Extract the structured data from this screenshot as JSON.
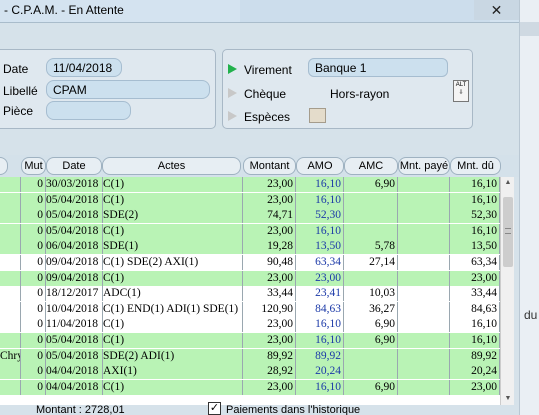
{
  "window": {
    "title": "- C.P.A.M. - En Attente",
    "close_glyph": "✕",
    "side_text": "du"
  },
  "form": {
    "date_label": "Date",
    "date_value": "11/04/2018",
    "libelle_label": "Libellé",
    "libelle_value": "CPAM",
    "piece_label": "Pièce",
    "piece_value": ""
  },
  "payment": {
    "virement_label": "Virement",
    "bank_value": "Banque 1",
    "alt_label": "ALT",
    "cheque_label": "Chèque",
    "horsrayon_label": "Hors-rayon",
    "especes_label": "Espèces",
    "selected": "Virement",
    "selected_color": "#22b14c"
  },
  "table": {
    "headers": [
      "Mut",
      "Date",
      "Actes",
      "Montant",
      "AMO",
      "AMC",
      "Mnt. payé",
      "Mnt. dû"
    ],
    "rows": [
      {
        "first": "",
        "mut": "0",
        "date": "30/03/2018",
        "actes": "C(1)",
        "montant": "23,00",
        "amo": "16,10",
        "amc": "6,90",
        "paye": "",
        "du": "16,10",
        "green": true
      },
      {
        "first": "",
        "mut": "0",
        "date": "05/04/2018",
        "actes": "C(1)",
        "montant": "23,00",
        "amo": "16,10",
        "amc": "",
        "paye": "",
        "du": "16,10",
        "green": true
      },
      {
        "first": "",
        "mut": "0",
        "date": "05/04/2018",
        "actes": "SDE(2)",
        "montant": "74,71",
        "amo": "52,30",
        "amc": "",
        "paye": "",
        "du": "52,30",
        "green": true
      },
      {
        "first": "",
        "mut": "0",
        "date": "05/04/2018",
        "actes": "C(1)",
        "montant": "23,00",
        "amo": "16,10",
        "amc": "",
        "paye": "",
        "du": "16,10",
        "green": true
      },
      {
        "first": "",
        "mut": "0",
        "date": "06/04/2018",
        "actes": "SDE(1)",
        "montant": "19,28",
        "amo": "13,50",
        "amc": "5,78",
        "paye": "",
        "du": "13,50",
        "green": true
      },
      {
        "first": "",
        "mut": "0",
        "date": "09/04/2018",
        "actes": "C(1) SDE(2) AXI(1)",
        "montant": "90,48",
        "amo": "63,34",
        "amc": "27,14",
        "paye": "",
        "du": "63,34",
        "green": false
      },
      {
        "first": "",
        "mut": "0",
        "date": "09/04/2018",
        "actes": "C(1)",
        "montant": "23,00",
        "amo": "23,00",
        "amc": "",
        "paye": "",
        "du": "23,00",
        "green": true
      },
      {
        "first": "",
        "mut": "0",
        "date": "18/12/2017",
        "actes": "ADC(1)",
        "montant": "33,44",
        "amo": "23,41",
        "amc": "10,03",
        "paye": "",
        "du": "33,44",
        "green": false
      },
      {
        "first": "",
        "mut": "0",
        "date": "10/04/2018",
        "actes": "C(1) END(1) ADI(1) SDE(1)",
        "montant": "120,90",
        "amo": "84,63",
        "amc": "36,27",
        "paye": "",
        "du": "84,63",
        "green": false
      },
      {
        "first": "",
        "mut": "0",
        "date": "11/04/2018",
        "actes": "C(1)",
        "montant": "23,00",
        "amo": "16,10",
        "amc": "6,90",
        "paye": "",
        "du": "16,10",
        "green": false
      },
      {
        "first": "",
        "mut": "0",
        "date": "05/04/2018",
        "actes": "C(1)",
        "montant": "23,00",
        "amo": "16,10",
        "amc": "6,90",
        "paye": "",
        "du": "16,10",
        "green": true
      },
      {
        "first": "Chry",
        "mut": "0",
        "date": "05/04/2018",
        "actes": "SDE(2) ADI(1)",
        "montant": "89,92",
        "amo": "89,92",
        "amc": "",
        "paye": "",
        "du": "89,92",
        "green": true
      },
      {
        "first": "",
        "mut": "0",
        "date": "04/04/2018",
        "actes": "AXI(1)",
        "montant": "28,92",
        "amo": "20,24",
        "amc": "",
        "paye": "",
        "du": "20,24",
        "green": true
      },
      {
        "first": "",
        "mut": "0",
        "date": "04/04/2018",
        "actes": "C(1)",
        "montant": "23,00",
        "amo": "16,10",
        "amc": "6,90",
        "paye": "",
        "du": "23,00",
        "green": true
      }
    ],
    "row_green": "#b9f3b5",
    "row_white": "#ffffff"
  },
  "footer": {
    "montant_text": "Montant :   2728,01",
    "historique_checked": "✓",
    "historique_label": "Paiements dans l'historique"
  }
}
